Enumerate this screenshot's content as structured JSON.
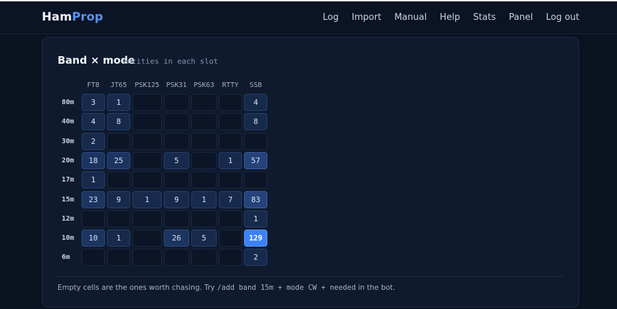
{
  "brand": {
    "part1": "Ham",
    "part2": "Prop"
  },
  "nav": [
    "Log",
    "Import",
    "Manual",
    "Help",
    "Stats",
    "Panel",
    "Log out"
  ],
  "card": {
    "title": "Band × mode",
    "subtitle": "entities in each slot",
    "columns": [
      "FT8",
      "JT65",
      "PSK125",
      "PSK31",
      "PSK63",
      "RTTY",
      "SSB"
    ],
    "rows": [
      {
        "band": "80m",
        "values": [
          3,
          1,
          null,
          null,
          null,
          null,
          4
        ]
      },
      {
        "band": "40m",
        "values": [
          4,
          8,
          null,
          null,
          null,
          null,
          8
        ]
      },
      {
        "band": "30m",
        "values": [
          2,
          null,
          null,
          null,
          null,
          null,
          null
        ]
      },
      {
        "band": "20m",
        "values": [
          18,
          25,
          null,
          5,
          null,
          1,
          57
        ]
      },
      {
        "band": "17m",
        "values": [
          1,
          null,
          null,
          null,
          null,
          null,
          null
        ]
      },
      {
        "band": "15m",
        "values": [
          23,
          9,
          1,
          9,
          1,
          7,
          83
        ]
      },
      {
        "band": "12m",
        "values": [
          null,
          null,
          null,
          null,
          null,
          null,
          1
        ]
      },
      {
        "band": "10m",
        "values": [
          10,
          1,
          null,
          26,
          5,
          null,
          129
        ]
      },
      {
        "band": "6m",
        "values": [
          null,
          null,
          null,
          null,
          null,
          null,
          2
        ]
      }
    ],
    "footnote": {
      "text1": "Empty cells are the ones worth chasing. Try ",
      "code": "/add band 15m + mode CW + needed",
      "text2": " in the bot."
    }
  }
}
